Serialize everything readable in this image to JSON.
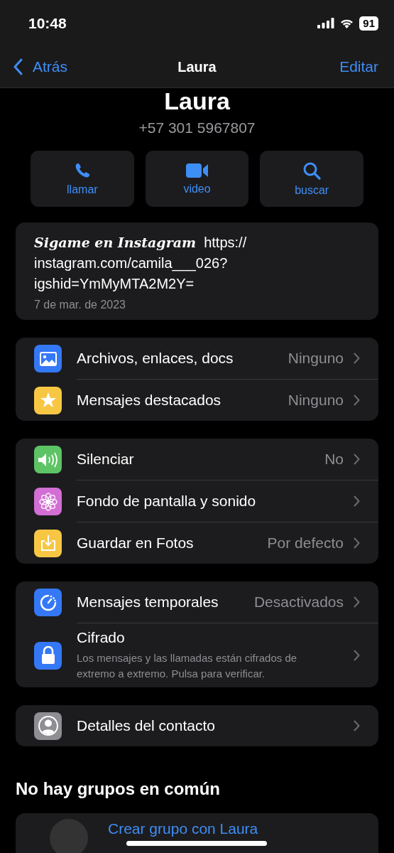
{
  "status_bar": {
    "time": "10:48",
    "battery": "91"
  },
  "nav": {
    "back": "Atrás",
    "title": "Laura",
    "action": "Editar"
  },
  "contact": {
    "name": "Laura",
    "phone": "+57 301 5967807"
  },
  "actions": [
    {
      "label": "llamar"
    },
    {
      "label": "video"
    },
    {
      "label": "buscar"
    }
  ],
  "bio": {
    "lead": "Sigame en Instagram",
    "text": "https://​instagram.com/camila___026?​igshid=YmMyMTA2M2Y=",
    "date": "7 de mar. de 2023"
  },
  "groups": [
    {
      "rows": [
        {
          "label": "Archivos, enlaces, docs",
          "value": "Ninguno"
        },
        {
          "label": "Mensajes destacados",
          "value": "Ninguno"
        }
      ]
    },
    {
      "rows": [
        {
          "label": "Silenciar",
          "value": "No"
        },
        {
          "label": "Fondo de pantalla y sonido"
        },
        {
          "label": "Guardar en Fotos",
          "value": "Por defecto"
        }
      ]
    },
    {
      "rows": [
        {
          "label": "Mensajes temporales",
          "value": "Desactivados"
        },
        {
          "label": "Cifrado",
          "subtitle": "Los mensajes y las llamadas están cifrados de extremo a extremo. Pulsa para verificar."
        }
      ]
    },
    {
      "rows": [
        {
          "label": "Detalles del contacto"
        }
      ]
    }
  ],
  "groups_heading": "No hay grupos en común",
  "create_group": {
    "label": "Crear grupo con Laura"
  }
}
